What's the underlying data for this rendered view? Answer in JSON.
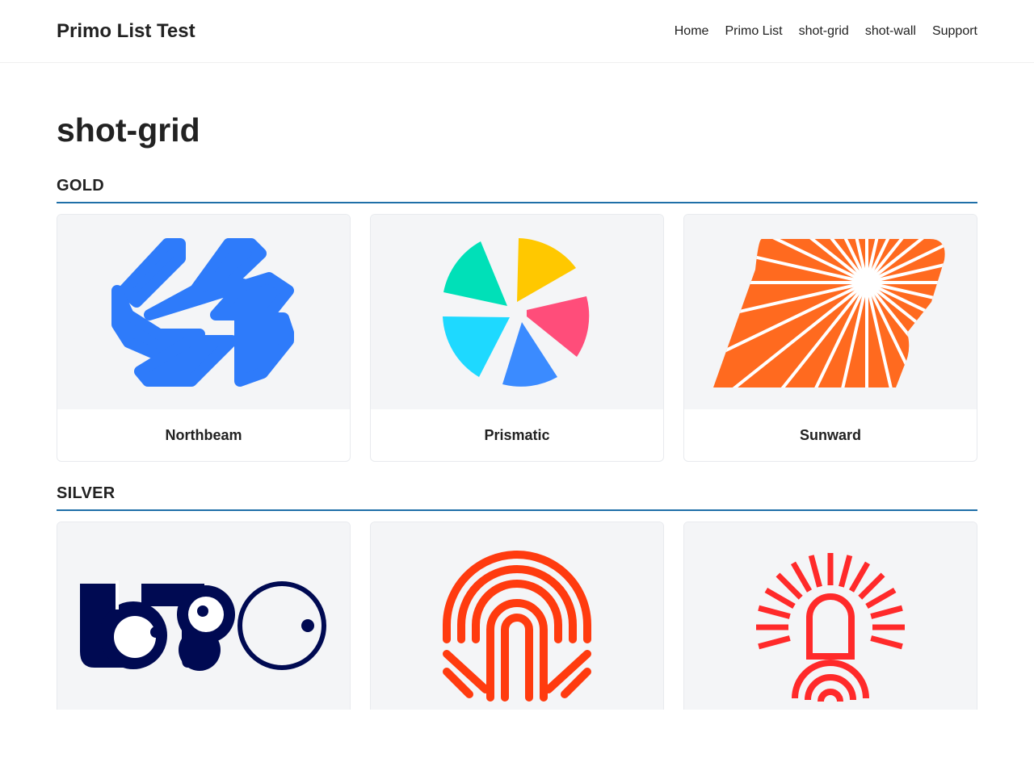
{
  "site": {
    "title": "Primo List Test"
  },
  "nav": [
    {
      "label": "Home"
    },
    {
      "label": "Primo List"
    },
    {
      "label": "shot-grid"
    },
    {
      "label": "shot-wall"
    },
    {
      "label": "Support"
    }
  ],
  "page": {
    "title": "shot-grid"
  },
  "sections": [
    {
      "title": "GOLD",
      "items": [
        {
          "name": "Northbeam",
          "icon": "northbeam-logo-icon",
          "color": "#2e7bfa"
        },
        {
          "name": "Prismatic",
          "icon": "prismatic-logo-icon",
          "colors": [
            "#00e0b8",
            "#ffc800",
            "#ff4d7a",
            "#3b8bff",
            "#1ed9ff"
          ]
        },
        {
          "name": "Sunward",
          "icon": "sunward-logo-icon",
          "color": "#ff6a1f"
        }
      ]
    },
    {
      "title": "SILVER",
      "items": [
        {
          "name": "",
          "icon": "logo-wordmark-icon",
          "color": "#000a52"
        },
        {
          "name": "",
          "icon": "arches-logo-icon",
          "color": "#ff3b0f"
        },
        {
          "name": "",
          "icon": "sunburst-arch-logo-icon",
          "color": "#ff2a2a"
        }
      ]
    }
  ],
  "colors": {
    "accent": "#1f6fa8",
    "card_bg": "#f4f5f7"
  }
}
